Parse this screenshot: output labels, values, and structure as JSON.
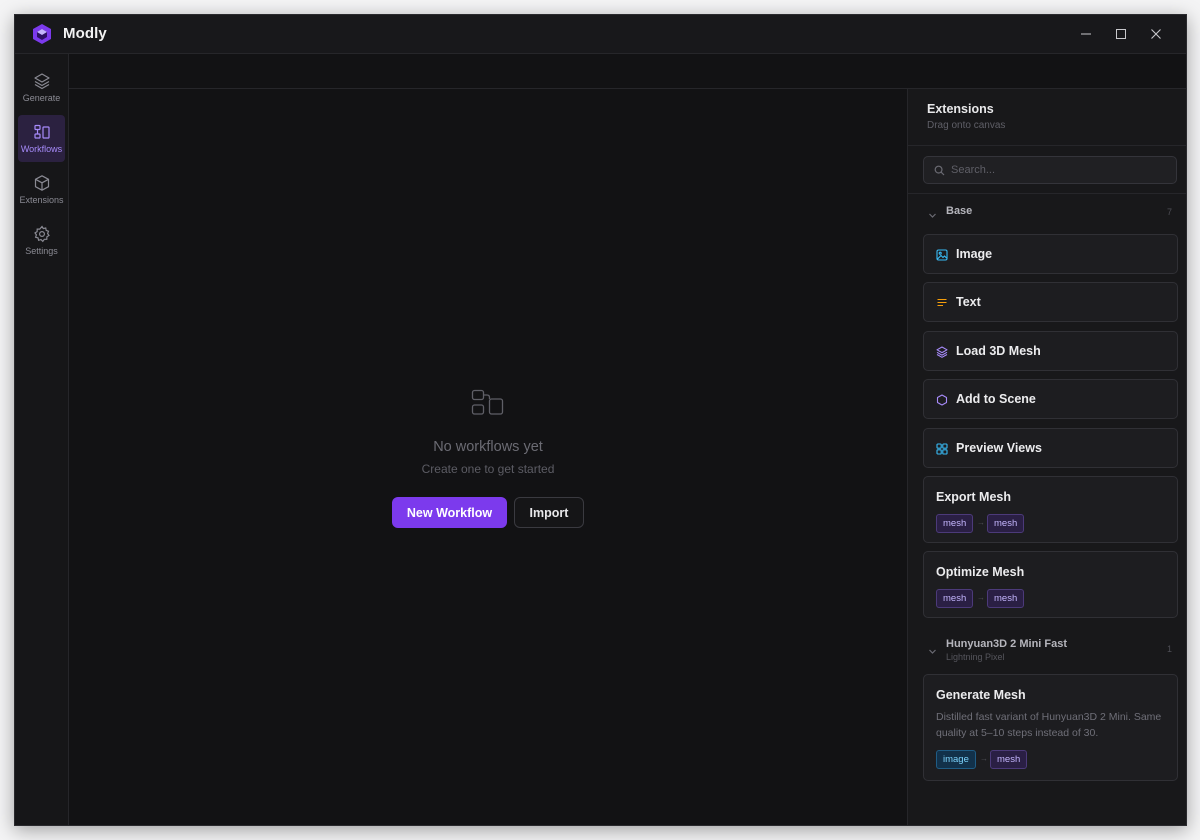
{
  "app": {
    "title": "Modly",
    "accent": "#7c3aed"
  },
  "sidebar": {
    "items": [
      {
        "label": "Generate",
        "icon": "layers-icon",
        "active": false
      },
      {
        "label": "Workflows",
        "icon": "workflow-icon",
        "active": true
      },
      {
        "label": "Extensions",
        "icon": "cube-icon",
        "active": false
      },
      {
        "label": "Settings",
        "icon": "gear-icon",
        "active": false
      }
    ]
  },
  "canvas": {
    "empty_title": "No workflows yet",
    "empty_subtitle": "Create one to get started",
    "new_workflow_label": "New Workflow",
    "import_label": "Import"
  },
  "panel": {
    "title": "Extensions",
    "subtitle": "Drag onto canvas",
    "search_placeholder": "Search...",
    "groups": [
      {
        "title": "Base",
        "count": "7",
        "nodes": [
          {
            "label": "Image",
            "icon": "image-icon",
            "icon_color": "#38bdf8"
          },
          {
            "label": "Text",
            "icon": "text-lines-icon",
            "icon_color": "#f59e0b"
          },
          {
            "label": "Load 3D Mesh",
            "icon": "layers-icon",
            "icon_color": "#a78bfa"
          },
          {
            "label": "Add to Scene",
            "icon": "hexagon-icon",
            "icon_color": "#a78bfa"
          },
          {
            "label": "Preview Views",
            "icon": "grid-icon",
            "icon_color": "#38bdf8"
          },
          {
            "label": "Export Mesh",
            "inputs": "mesh",
            "outputs": "mesh"
          },
          {
            "label": "Optimize Mesh",
            "inputs": "mesh",
            "outputs": "mesh"
          }
        ]
      },
      {
        "title": "Hunyuan3D 2 Mini Fast",
        "subtitle": "Lightning Pixel",
        "count": "1",
        "nodes": [
          {
            "label": "Generate Mesh",
            "description": "Distilled fast variant of Hunyuan3D 2 Mini. Same quality at 5–10 steps instead of 30.",
            "inputs": "image",
            "outputs": "mesh"
          }
        ]
      }
    ],
    "arrow": "→"
  }
}
